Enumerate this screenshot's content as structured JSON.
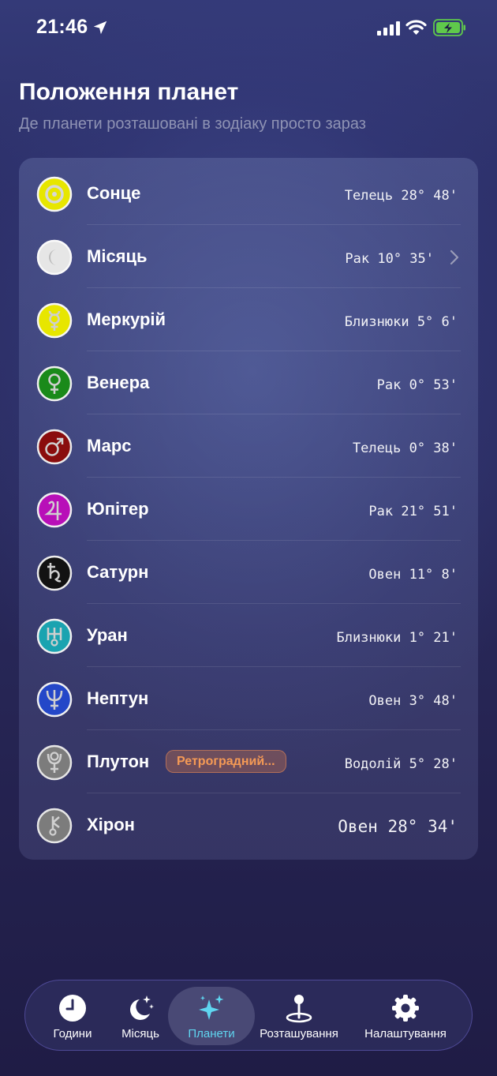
{
  "status": {
    "time": "21:46"
  },
  "header": {
    "title": "Положення планет",
    "subtitle": "Де планети розташовані в зодіаку просто зараз"
  },
  "planets": [
    {
      "name": "Сонце",
      "position": "Телець 28° 48'",
      "icon": "sun-icon",
      "color": "#e7e600"
    },
    {
      "name": "Місяць",
      "position": "Рак 10° 35'",
      "icon": "moon-icon",
      "color": "#d8d8d8"
    },
    {
      "name": "Меркурій",
      "position": "Близнюки 5° 6'",
      "icon": "mercury-icon",
      "color": "#e7e600"
    },
    {
      "name": "Венера",
      "position": "Рак 0° 53'",
      "icon": "venus-icon",
      "color": "#1a8a1a"
    },
    {
      "name": "Марс",
      "position": "Телець 0° 38'",
      "icon": "mars-icon",
      "color": "#8a0d0d"
    },
    {
      "name": "Юпітер",
      "position": "Рак 21° 51'",
      "icon": "jupiter-icon",
      "color": "#b80fb8"
    },
    {
      "name": "Сатурн",
      "position": "Овен 11° 8'",
      "icon": "saturn-icon",
      "color": "#121212"
    },
    {
      "name": "Уран",
      "position": "Близнюки 1° 21'",
      "icon": "uranus-icon",
      "color": "#1aa3b0"
    },
    {
      "name": "Нептун",
      "position": "Овен 3° 48'",
      "icon": "neptune-icon",
      "color": "#2447c8"
    },
    {
      "name": "Плутон",
      "position": "Водолій 5° 28'",
      "icon": "pluto-icon",
      "color": "#7c7c7c",
      "badge": "Ретроградний..."
    },
    {
      "name": "Хірон",
      "position": "Овен 28° 34'",
      "icon": "chiron-icon",
      "color": "#7c7c7c"
    }
  ],
  "tabs": [
    {
      "label": "Години",
      "icon": "clock-icon",
      "active": false
    },
    {
      "label": "Місяць",
      "icon": "moon-stars-icon",
      "active": false
    },
    {
      "label": "Планети",
      "icon": "sparkles-icon",
      "active": true
    },
    {
      "label": "Розташування",
      "icon": "map-pin-icon",
      "active": false
    },
    {
      "label": "Налаштування",
      "icon": "gear-icon",
      "active": false
    }
  ],
  "colors": {
    "accent": "#5fd6f0",
    "badge_text": "#f59a55",
    "subtitle": "#8f93b4"
  }
}
